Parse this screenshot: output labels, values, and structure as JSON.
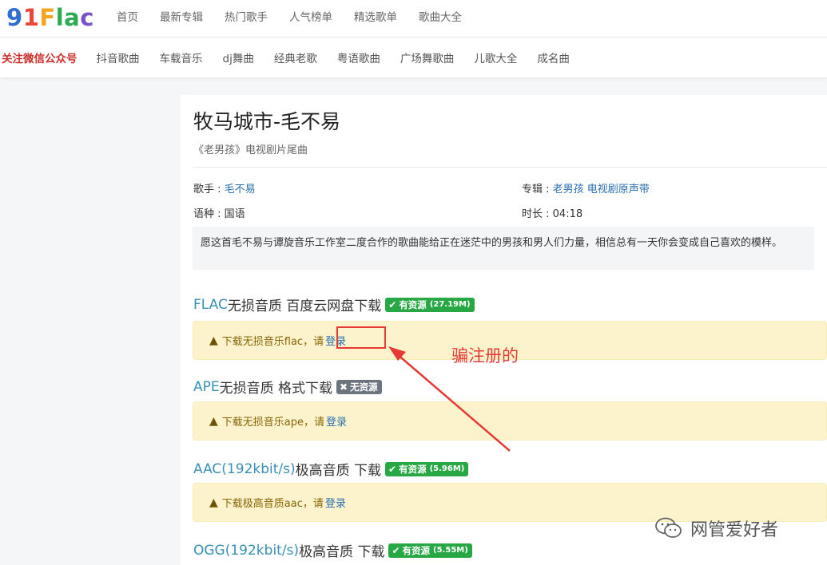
{
  "logo": {
    "part1": "9",
    "part2": "1",
    "part3": "F",
    "part4": "la",
    "part5": "c"
  },
  "main_nav": [
    "首页",
    "最新专辑",
    "热门歌手",
    "人气榜单",
    "精选歌单",
    "歌曲大全"
  ],
  "sub_nav": {
    "wechat": "关注微信公众号",
    "items": [
      "抖音歌曲",
      "车载音乐",
      "dj舞曲",
      "经典老歌",
      "粤语歌曲",
      "广场舞歌曲",
      "儿歌大全",
      "成名曲"
    ]
  },
  "song": {
    "title": "牧马城市-毛不易",
    "subtitle": "《老男孩》电视剧片尾曲",
    "singer_label": "歌手 : ",
    "singer": "毛不易",
    "album_label": "专辑 : ",
    "album": "老男孩 电视剧原声带",
    "lang_label": "语种 : ",
    "lang": "国语",
    "duration_label": "时长 : ",
    "duration": "04:18",
    "description": "愿这首毛不易与谭旋音乐工作室二度合作的歌曲能给正在迷茫中的男孩和男人们力量，相信总有一天你会变成自己喜欢的模样。"
  },
  "downloads": [
    {
      "fmt": "FLAC",
      "rest": " 无损音质 百度云网盘下载",
      "badge": "有资源",
      "size": "(27.19M)",
      "available": true,
      "alert": "下载无损音乐flac，请 ",
      "login": "登录"
    },
    {
      "fmt": "APE",
      "rest": " 无损音质 格式下载",
      "badge": "无资源",
      "size": "",
      "available": false,
      "alert": "下载无损音乐ape，请 ",
      "login": "登录"
    },
    {
      "fmt": "AAC(192kbit/s)",
      "rest": " 极高音质 下载",
      "badge": "有资源",
      "size": "(5.96M)",
      "available": true,
      "alert": "下载极高音质aac，请 ",
      "login": "登录"
    },
    {
      "fmt": "OGG(192kbit/s)",
      "rest": " 极高音质 下载",
      "badge": "有资源",
      "size": "(5.55M)",
      "available": true
    }
  ],
  "annotation": "骗注册的",
  "watermark": "网管爱好者",
  "colors": {
    "accent": "#2a6fb0",
    "ok": "#28a745",
    "no": "#6c757d",
    "alert_bg": "#fcf3cd",
    "annotation": "#e53935"
  }
}
